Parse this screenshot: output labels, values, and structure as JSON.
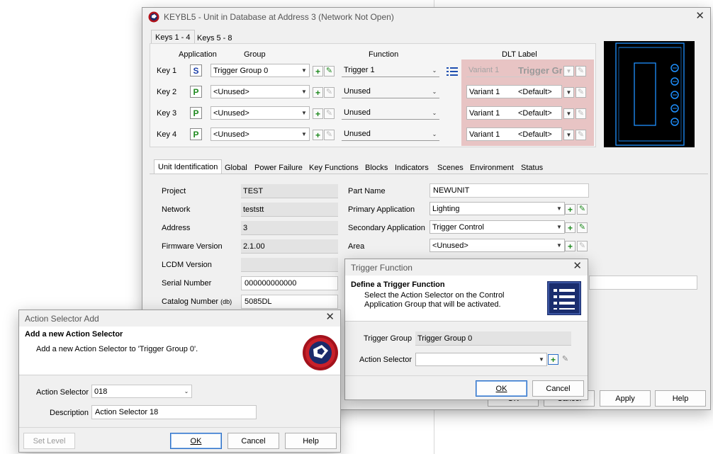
{
  "main_window": {
    "title": "KEYBL5 - Unit in Database at Address 3 (Network Not Open)",
    "key_tabs": [
      "Keys 1 - 4",
      "Keys 5 - 8"
    ],
    "columns": {
      "application": "Application",
      "group": "Group",
      "function": "Function",
      "dlt_label": "DLT Label"
    },
    "keys": [
      {
        "label": "Key 1",
        "app": "S",
        "group": "Trigger Group 0",
        "function": "Trigger 1",
        "variant": "Variant 1",
        "dlt": "Trigger Gro"
      },
      {
        "label": "Key 2",
        "app": "P",
        "group": "<Unused>",
        "function": "Unused",
        "variant": "Variant 1",
        "dlt": "<Default>"
      },
      {
        "label": "Key 3",
        "app": "P",
        "group": "<Unused>",
        "function": "Unused",
        "variant": "Variant 1",
        "dlt": "<Default>"
      },
      {
        "label": "Key 4",
        "app": "P",
        "group": "<Unused>",
        "function": "Unused",
        "variant": "Variant 1",
        "dlt": "<Default>"
      }
    ],
    "detail_tabs": [
      "Unit Identification",
      "Global",
      "Power Failure",
      "Key Functions",
      "Blocks",
      "Indicators",
      "Scenes",
      "Environment",
      "Status"
    ],
    "unit_id": {
      "project_label": "Project",
      "project": "TEST",
      "network_label": "Network",
      "network": "teststt",
      "address_label": "Address",
      "address": "3",
      "firmware_label": "Firmware Version",
      "firmware": "2.1.00",
      "lcdm_label": "LCDM Version",
      "lcdm": "",
      "serial_label": "Serial Number",
      "serial": "000000000000",
      "catalog_label": "Catalog Number",
      "catalog_unit": "(db)",
      "catalog": "5085DL",
      "part_name_label": "Part Name",
      "part_name": "NEWUNIT",
      "primary_app_label": "Primary Application",
      "primary_app": "Lighting",
      "secondary_app_label": "Secondary Application",
      "secondary_app": "Trigger Control",
      "area_label": "Area",
      "area": "<Unused>"
    },
    "buttons": {
      "ok": "OK",
      "cancel": "Cancel",
      "apply": "Apply",
      "help": "Help"
    },
    "accent_colors": {
      "dlt_panel": "#e8c4c4",
      "preview_bg": "#000000",
      "preview_line": "#1e90ff"
    }
  },
  "trigger_dialog": {
    "title": "Trigger Function",
    "heading": "Define a Trigger Function",
    "description": "Select the Action Selector on the Control Application Group that will be activated.",
    "trigger_group_label": "Trigger Group",
    "trigger_group": "Trigger Group 0",
    "action_selector_label": "Action Selector",
    "action_selector": "",
    "ok": "OK",
    "cancel": "Cancel"
  },
  "action_dialog": {
    "title": "Action Selector Add",
    "heading": "Add a new Action Selector",
    "description": "Add a new Action Selector to 'Trigger Group 0'.",
    "action_selector_label": "Action Selector",
    "action_selector": "018",
    "description_label": "Description",
    "description_value": "Action Selector 18",
    "set_level": "Set Level",
    "ok": "OK",
    "cancel": "Cancel",
    "help": "Help"
  }
}
